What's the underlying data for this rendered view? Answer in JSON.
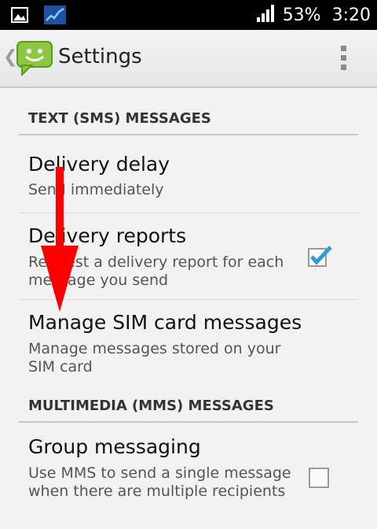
{
  "status_bar": {
    "battery_percent": "53%",
    "time": "3:20",
    "icons": [
      "image-icon",
      "stock-chart-icon",
      "signal-icon",
      "battery-icon"
    ]
  },
  "action_bar": {
    "title": "Settings",
    "app_icon": "messaging-app-icon",
    "overflow_icon": "overflow-menu-icon"
  },
  "sections": [
    {
      "header": "TEXT (SMS) MESSAGES",
      "items": [
        {
          "title": "Delivery delay",
          "summary": "Send immediately"
        },
        {
          "title": "Delivery reports",
          "summary": "Request a delivery report for each message you send",
          "checked": true
        },
        {
          "title": "Manage SIM card messages",
          "summary": "Manage messages stored on your SIM card"
        }
      ]
    },
    {
      "header": "MULTIMEDIA (MMS) MESSAGES",
      "items": [
        {
          "title": "Group messaging",
          "summary": "Use MMS to send a single message when there are multiple recipients",
          "checked": false
        }
      ]
    }
  ],
  "annotation": {
    "color": "#ff0000",
    "shape": "down-arrow"
  }
}
